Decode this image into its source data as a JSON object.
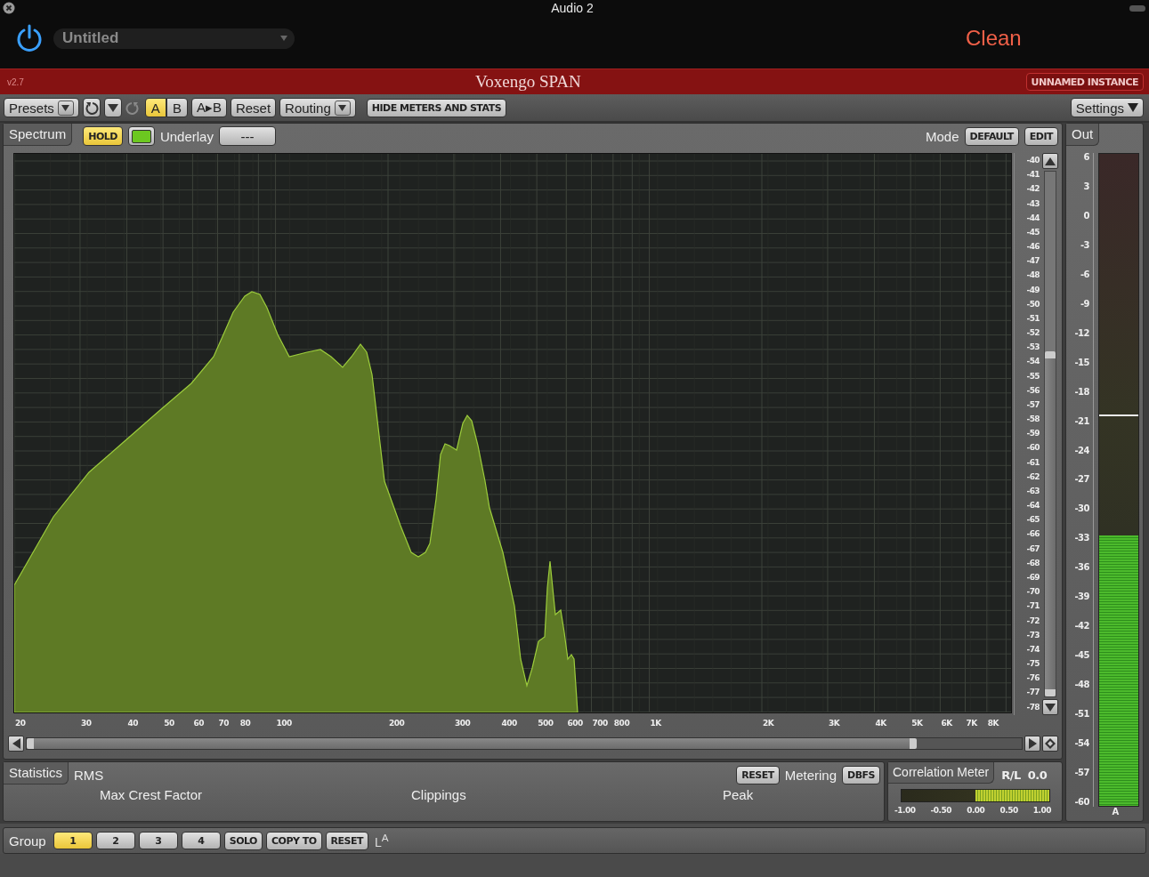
{
  "window": {
    "title": "Audio 2"
  },
  "header": {
    "preset": "Untitled",
    "status": "Clean"
  },
  "titlebar": {
    "version": "v2.7",
    "product": "Voxengo SPAN",
    "instance": "UNNAMED INSTANCE"
  },
  "toolbar": {
    "presets": "Presets",
    "ab": [
      {
        "label": "A",
        "selected": true
      },
      {
        "label": "B",
        "selected": false
      }
    ],
    "copy": "A▸B",
    "reset": "Reset",
    "routing": "Routing",
    "hide": "HIDE METERS AND STATS",
    "settings": "Settings"
  },
  "spectrum": {
    "tab": "Spectrum",
    "hold": {
      "label": "HOLD",
      "on": true
    },
    "underlay_label": "Underlay",
    "underlay": "---",
    "mode_label": "Mode",
    "modes": [
      "DEFAULT",
      "EDIT"
    ],
    "y_labels": [
      "-40",
      "-41",
      "-42",
      "-43",
      "-44",
      "-45",
      "-46",
      "-47",
      "-48",
      "-49",
      "-50",
      "-51",
      "-52",
      "-53",
      "-54",
      "-55",
      "-56",
      "-57",
      "-58",
      "-59",
      "-60",
      "-61",
      "-62",
      "-63",
      "-64",
      "-65",
      "-66",
      "-67",
      "-68",
      "-69",
      "-70",
      "-71",
      "-72",
      "-73",
      "-74",
      "-75",
      "-76",
      "-77",
      "-78"
    ],
    "x_labels": [
      "20",
      "30",
      "40",
      "50",
      "60",
      "70",
      "80",
      "100",
      "200",
      "300",
      "400",
      "500",
      "600",
      "700",
      "800",
      "1K",
      "2K",
      "3K",
      "4K",
      "5K",
      "6K",
      "7K",
      "8K"
    ]
  },
  "out": {
    "tab": "Out",
    "scale": [
      "6",
      "3",
      "0",
      "-3",
      "-6",
      "-9",
      "-12",
      "-15",
      "-18",
      "-21",
      "-24",
      "-27",
      "-30",
      "-33",
      "-36",
      "-39",
      "-42",
      "-45",
      "-48",
      "-51",
      "-54",
      "-57",
      "-60"
    ],
    "level": 0.415,
    "hold": {
      "level": 0.598
    },
    "channel": "A"
  },
  "statistics": {
    "tab": "Statistics",
    "rms": "RMS",
    "reset": "RESET",
    "metering_label": "Metering",
    "metering": "DBFS",
    "fields": [
      "Max Crest Factor",
      "Clippings",
      "Peak"
    ]
  },
  "correlation": {
    "title": "Correlation Meter",
    "mode": "R/L",
    "value": "0.0",
    "level": 0.5,
    "scale": [
      "-1.00",
      "-0.50",
      "0.00",
      "0.50",
      "1.00"
    ]
  },
  "group": {
    "label": "Group",
    "buttons": [
      {
        "label": "1",
        "selected": true
      },
      {
        "label": "2",
        "selected": false
      },
      {
        "label": "3",
        "selected": false
      },
      {
        "label": "4",
        "selected": false
      }
    ],
    "actions": [
      "SOLO",
      "COPY TO",
      "RESET"
    ],
    "note": "L$^{A}$"
  }
}
